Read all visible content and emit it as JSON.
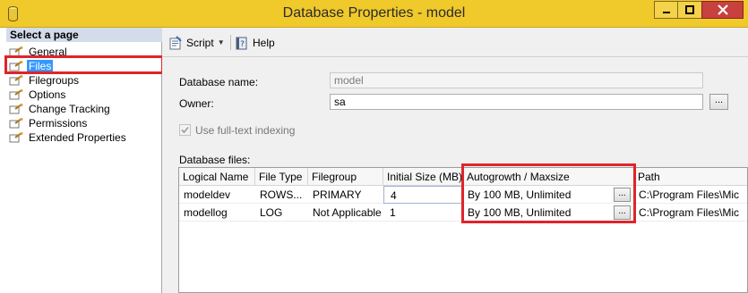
{
  "window": {
    "title": "Database Properties - model",
    "controls": {
      "minimize": "minimize-icon",
      "maximize": "maximize-icon",
      "close": "close-icon"
    }
  },
  "left_pane": {
    "header": "Select a page",
    "pages": [
      {
        "label": "General",
        "icon": "page-wrench-icon",
        "selected": false
      },
      {
        "label": "Files",
        "icon": "page-wrench-icon",
        "selected": true
      },
      {
        "label": "Filegroups",
        "icon": "page-wrench-icon",
        "selected": false
      },
      {
        "label": "Options",
        "icon": "page-wrench-icon",
        "selected": false
      },
      {
        "label": "Change Tracking",
        "icon": "page-wrench-icon",
        "selected": false
      },
      {
        "label": "Permissions",
        "icon": "page-wrench-icon",
        "selected": false
      },
      {
        "label": "Extended Properties",
        "icon": "page-wrench-icon",
        "selected": false
      }
    ]
  },
  "toolbar": {
    "script_label": "Script",
    "help_label": "Help"
  },
  "form": {
    "database_name_label": "Database name:",
    "database_name_value": "model",
    "owner_label": "Owner:",
    "owner_value": "sa",
    "owner_browse": "...",
    "fulltext_label": "Use full-text indexing",
    "fulltext_checked": true,
    "database_files_label": "Database files:"
  },
  "files_grid": {
    "columns": [
      "Logical Name",
      "File Type",
      "Filegroup",
      "Initial Size (MB)",
      "Autogrowth / Maxsize",
      "Path"
    ],
    "rows": [
      {
        "logical_name": "modeldev",
        "file_type": "ROWS...",
        "filegroup": "PRIMARY",
        "initial_size": "4",
        "autogrowth": "By 100 MB, Unlimited",
        "browse": "...",
        "path": "C:\\Program Files\\Mic"
      },
      {
        "logical_name": "modellog",
        "file_type": "LOG",
        "filegroup": "Not Applicable",
        "initial_size": "1",
        "autogrowth": "By 100 MB, Unlimited",
        "browse": "...",
        "path": "C:\\Program Files\\Mic"
      }
    ]
  },
  "colors": {
    "titlebar": "#f0c92a",
    "selection": "#3399ff",
    "callout": "#e0242a",
    "pane_header": "#d4dceb"
  }
}
